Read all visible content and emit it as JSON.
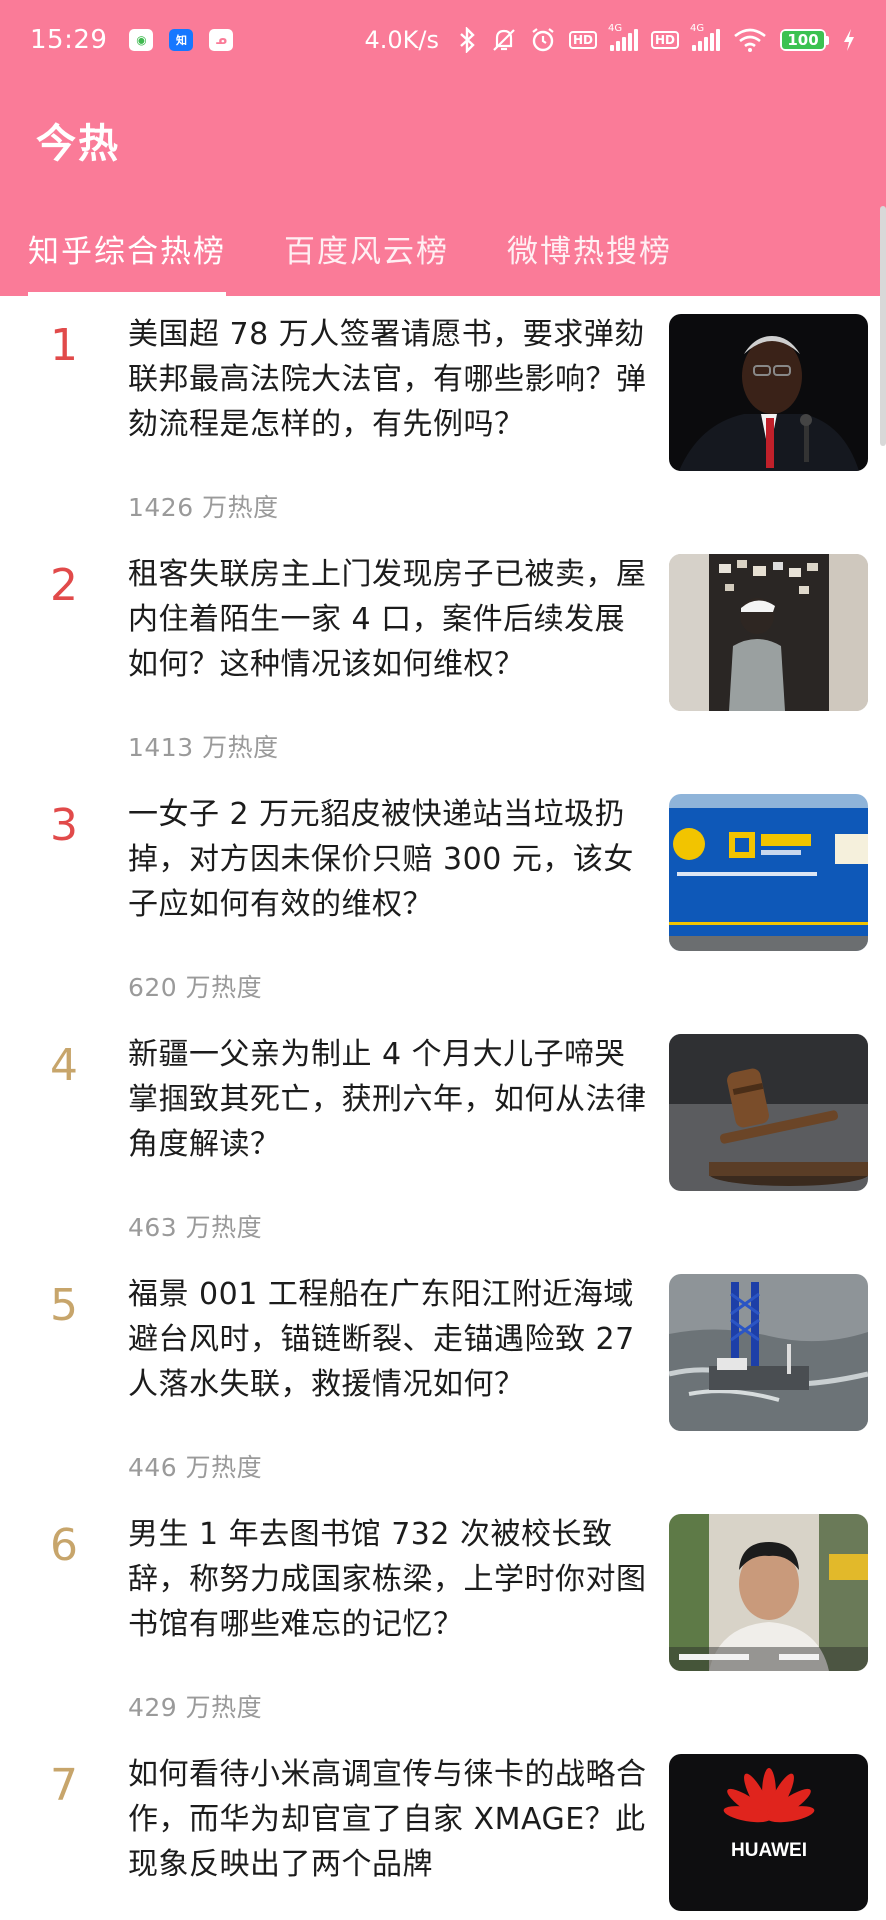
{
  "status_bar": {
    "time": "15:29",
    "app_icons": [
      "wechat-icon",
      "zhihu-icon",
      "app-icon"
    ],
    "net_speed": "4.0K/s",
    "hd1": "HD",
    "net1": "4G",
    "hd2": "HD",
    "net2": "4G",
    "battery": "100"
  },
  "app_bar": {
    "title": "今热"
  },
  "tabs": [
    {
      "label": "知乎综合热榜",
      "active": true
    },
    {
      "label": "百度风云榜",
      "active": false
    },
    {
      "label": "微博热搜榜",
      "active": false
    }
  ],
  "colors": {
    "primary": "#fa7b98",
    "rank_top": "#e14a4a",
    "rank_other": "#c7a56b",
    "meta": "#9a9a9a"
  },
  "items": [
    {
      "rank": "1",
      "title": "美国超 78 万人签署请愿书，要求弹劾联邦最高法院大法官，有哪些影响？弹劾流程是怎样的，有先例吗？",
      "heat": "1426 万热度",
      "image": "judge-photo"
    },
    {
      "rank": "2",
      "title": "租客失联房主上门发现房子已被卖，屋内住着陌生一家 4 口，案件后续发展如何？这种情况该如何维权？",
      "heat": "1413 万热度",
      "image": "apartment-door-photo"
    },
    {
      "rank": "3",
      "title": "一女子 2 万元貂皮被快递站当垃圾扔掉，对方因未保价只赔 300 元，该女子应如何有效的维权？",
      "heat": "620 万热度",
      "image": "delivery-truck-photo"
    },
    {
      "rank": "4",
      "title": "新疆一父亲为制止 4 个月大儿子啼哭掌掴致其死亡，获刑六年，如何从法律角度解读？",
      "heat": "463 万热度",
      "image": "gavel-photo"
    },
    {
      "rank": "5",
      "title": "福景 001 工程船在广东阳江附近海域避台风时，锚链断裂、走锚遇险致 27 人落水失联，救援情况如何？",
      "heat": "446 万热度",
      "image": "engineering-ship-photo"
    },
    {
      "rank": "6",
      "title": "男生 1 年去图书馆 732 次被校长致辞，称努力成国家栋梁，上学时你对图书馆有哪些难忘的记忆？",
      "heat": "429 万热度",
      "image": "student-photo"
    },
    {
      "rank": "7",
      "title": "如何看待小米高调宣传与徕卡的战略合作，而华为却官宣了自家 XMAGE？此现象反映出了两个品牌",
      "heat": "",
      "image": "huawei-logo-photo",
      "image_text": "HUAWEI"
    }
  ]
}
